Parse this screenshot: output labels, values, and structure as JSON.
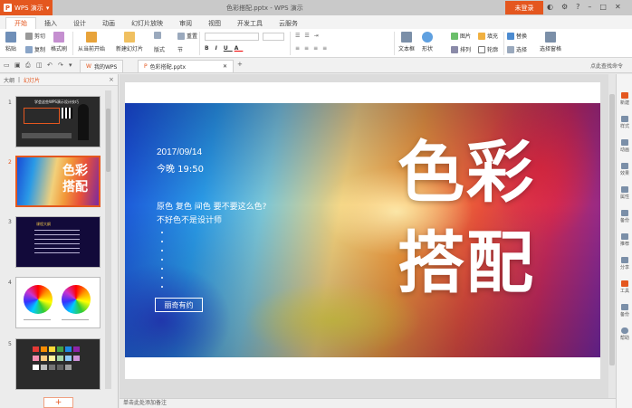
{
  "titlebar": {
    "app_label": "WPS 演示",
    "title": "色彩搭配.pptx - WPS 演示",
    "login_label": "未登录",
    "colors": {
      "accent": "#e4571f",
      "bar": "#c9c9c9"
    }
  },
  "tabs": [
    "开始",
    "插入",
    "设计",
    "动画",
    "幻灯片放映",
    "审阅",
    "视图",
    "开发工具",
    "云服务"
  ],
  "toolbar": {
    "paste": "粘贴",
    "cut": "剪切",
    "copy": "复制",
    "format_painter": "格式刷",
    "from_current": "从当前开始",
    "new_slide": "新建幻灯片",
    "layout": "版式",
    "section": "节",
    "reset": "重置",
    "text_box": "文本框",
    "shapes": "形状",
    "picture": "图片",
    "arrange": "排列",
    "fill": "填充",
    "outline": "轮廓",
    "replace": "替换",
    "select": "选择",
    "select_pane": "选择窗格"
  },
  "docbar": {
    "tabs": [
      {
        "label": "我的WPS"
      },
      {
        "label": "色彩搭配.pptx"
      }
    ],
    "add": "+",
    "feedback": "点此查找命令"
  },
  "leftpanel": {
    "outline_tab": "大纲",
    "slides_tab": "幻灯片",
    "close": "×",
    "slide_numbers": [
      "1",
      "2",
      "3",
      "4",
      "5"
    ],
    "thumb1_title": "学会这些WPS演示设计技巧",
    "thumb2_title": "色彩搭配",
    "thumb3_title": "课程大纲",
    "add_slide": "+"
  },
  "slide": {
    "date": "2017/09/14",
    "time": "今晚 19:50",
    "line1": "原色 复色 间色 要不要这么色?",
    "line2": "不好色不是设计师",
    "tag": "丽奇有约",
    "title_line1": "色彩",
    "title_line2": "搭配"
  },
  "rpanel": {
    "items": [
      "新建",
      "样式",
      "动画",
      "效果",
      "属性",
      "备份",
      "推荐",
      "分享",
      "工具",
      "备份",
      "帮助"
    ]
  },
  "notes": {
    "placeholder": "单击此处添加备注"
  }
}
